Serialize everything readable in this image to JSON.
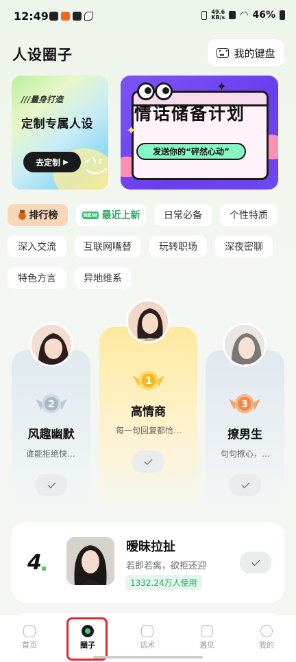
{
  "status_bar": {
    "time": "12:49",
    "net_speed": "49.6",
    "net_unit": "KB/s",
    "battery": "46%"
  },
  "header": {
    "title": "人设圈子",
    "keyboard_button": "我的键盘"
  },
  "banners": {
    "left": {
      "tag": "///量身打造",
      "title": "定制专属人设",
      "button": "去定制"
    },
    "right": {
      "title": "情话储备计划",
      "subtitle": "发送你的“砰然心动”"
    }
  },
  "tags": [
    {
      "label": "排行榜",
      "active": true
    },
    {
      "label": "最近上新",
      "badge": "NEW"
    },
    {
      "label": "日常必备"
    },
    {
      "label": "个性特质"
    },
    {
      "label": "深入交流"
    },
    {
      "label": "互联网嘴替"
    },
    {
      "label": "玩转职场"
    },
    {
      "label": "深夜密聊"
    },
    {
      "label": "特色方言"
    },
    {
      "label": "异地维系"
    }
  ],
  "podium": {
    "first": {
      "rank": "1",
      "name": "高情商",
      "desc": "每一句回复都恰…"
    },
    "second": {
      "rank": "2",
      "name": "风趣幽默",
      "desc": "谁能拒绝快…"
    },
    "third": {
      "rank": "3",
      "name": "撩男生",
      "desc": "句句撩心，…"
    }
  },
  "ranked_list": [
    {
      "rank": "4",
      "name": "暧昧拉扯",
      "desc": "若即若离，欲拒还迎",
      "users": "1332.24万人使用"
    }
  ],
  "bottom_nav": [
    {
      "label": "首页"
    },
    {
      "label": "圈子",
      "active": true
    },
    {
      "label": "话术"
    },
    {
      "label": "遇见"
    },
    {
      "label": "我的"
    }
  ],
  "colors": {
    "accent_green": "#2bc46b",
    "rank_tab_bg": "#f7d7b8",
    "banner_purple": "#6a3ef0",
    "highlight_red": "#e0282e"
  }
}
